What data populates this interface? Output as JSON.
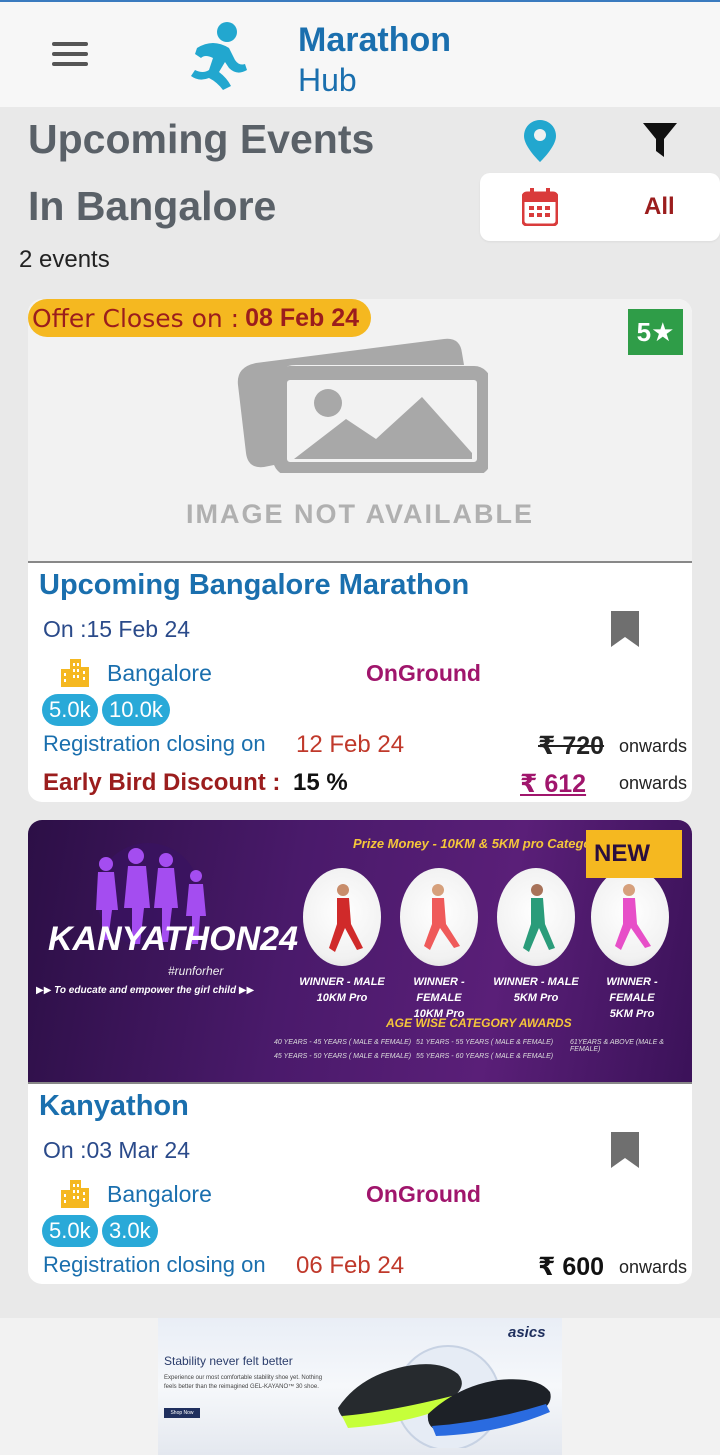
{
  "header": {
    "brand_line1": "Marathon",
    "brand_line2": "Hub",
    "icons": [
      "menu-icon",
      "runner-logo-icon"
    ],
    "brand_color": "#1a6fae"
  },
  "page": {
    "title_line1": "Upcoming Events",
    "title_line2": "In Bangalore",
    "date_filter_value": "All",
    "events_count": "2 events",
    "icons": [
      "location-pin-icon",
      "filter-icon",
      "calendar-icon"
    ]
  },
  "events": [
    {
      "offer_label": "Offer Closes on :",
      "offer_date": "08 Feb 24",
      "rating": "5★",
      "image_placeholder": "IMAGE NOT AVAILABLE",
      "title": "Upcoming Bangalore Marathon",
      "date": "On :15 Feb 24",
      "city": "Bangalore",
      "mode": "OnGround",
      "distances": [
        "5.0k",
        "10.0k"
      ],
      "reg_label": "Registration closing on",
      "reg_date": "12 Feb 24",
      "original_price": "₹ 720",
      "onwards": "onwards",
      "early_bird_label": "Early Bird Discount :",
      "early_bird_value": "15 %",
      "discount_price": "₹ 612",
      "discount_onwards": "onwards"
    },
    {
      "badge": "NEW",
      "banner": {
        "prize_text": "Prize Money - 10KM & 5KM pro Category",
        "event_name": "KANYATHON24",
        "hashtag": "#runforher",
        "tagline": "To educate and empower the girl child",
        "winners": [
          "WINNER - MALE",
          "WINNER - FEMALE",
          "WINNER - MALE",
          "WINNER - FEMALE"
        ],
        "winner_cats": [
          "10KM Pro",
          "10KM Pro",
          "5KM Pro",
          "5KM Pro"
        ],
        "age_awards": "AGE WISE CATEGORY AWARDS",
        "age_groups": [
          "40 YEARS - 45 YEARS ( MALE & FEMALE)",
          "45 YEARS - 50 YEARS ( MALE & FEMALE)",
          "51 YEARS - 55 YEARS ( MALE & FEMALE)",
          "55 YEARS - 60 YEARS ( MALE & FEMALE)",
          "61YEARS & ABOVE (MALE & FEMALE)"
        ]
      },
      "title": "Kanyathon",
      "date": "On :03 Mar 24",
      "city": "Bangalore",
      "mode": "OnGround",
      "distances": [
        "5.0k",
        "3.0k"
      ],
      "reg_label": "Registration closing on",
      "reg_date": "06 Feb 24",
      "price": "₹ 600",
      "onwards": "onwards"
    }
  ],
  "ad": {
    "brand": "asics",
    "headline": "Stability never felt better",
    "body": "Experience our most comfortable stability shoe yet. Nothing feels better than the reimagined GEL-KAYANO™ 30 shoe.",
    "cta": "Shop Now"
  }
}
